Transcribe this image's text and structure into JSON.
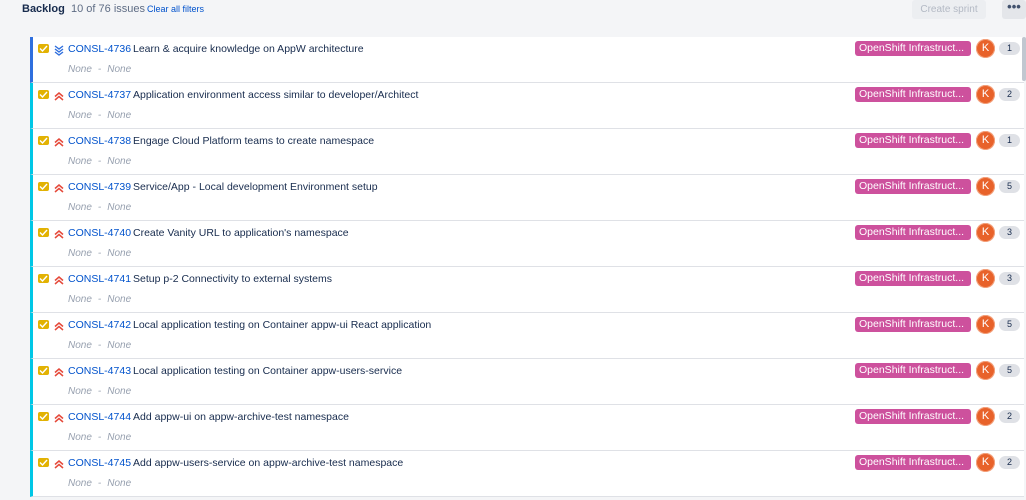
{
  "header": {
    "title": "Backlog",
    "issue_count": "10 of 76 issues",
    "clear_filters": "Clear all filters",
    "create_sprint": "Create sprint",
    "more_icon": "more-horizontal-icon",
    "more_label": "•••"
  },
  "colors": {
    "epic": "#cd519d",
    "avatar": "#e8622a",
    "story_icon": "#e2b203",
    "priority_high": "#e5493a",
    "priority_lowest": "#2f6fde"
  },
  "issues": [
    {
      "key": "CONSL-4736",
      "summary": "Learn & acquire knowledge on AppW architecture",
      "type_icon": "story-icon",
      "priority": "lowest",
      "priority_icon": "priority-lowest-icon",
      "meta1": "None",
      "meta2": "None",
      "epic": "OpenShift Infrastruct...",
      "avatar": "K",
      "points": "1"
    },
    {
      "key": "CONSL-4737",
      "summary": "Application environment access similar to developer/Architect",
      "type_icon": "story-icon",
      "priority": "high",
      "priority_icon": "priority-high-icon",
      "meta1": "None",
      "meta2": "None",
      "epic": "OpenShift Infrastruct...",
      "avatar": "K",
      "points": "2"
    },
    {
      "key": "CONSL-4738",
      "summary": "Engage Cloud Platform teams to create namespace",
      "type_icon": "story-icon",
      "priority": "high",
      "priority_icon": "priority-high-icon",
      "meta1": "None",
      "meta2": "None",
      "epic": "OpenShift Infrastruct...",
      "avatar": "K",
      "points": "1"
    },
    {
      "key": "CONSL-4739",
      "summary": "Service/App - Local development Environment setup",
      "type_icon": "story-icon",
      "priority": "high",
      "priority_icon": "priority-high-icon",
      "meta1": "None",
      "meta2": "None",
      "epic": "OpenShift Infrastruct...",
      "avatar": "K",
      "points": "5"
    },
    {
      "key": "CONSL-4740",
      "summary": "Create Vanity URL to application's namespace",
      "type_icon": "story-icon",
      "priority": "high",
      "priority_icon": "priority-high-icon",
      "meta1": "None",
      "meta2": "None",
      "epic": "OpenShift Infrastruct...",
      "avatar": "K",
      "points": "3"
    },
    {
      "key": "CONSL-4741",
      "summary": "Setup p-2 Connectivity to external systems",
      "type_icon": "story-icon",
      "priority": "high",
      "priority_icon": "priority-high-icon",
      "meta1": "None",
      "meta2": "None",
      "epic": "OpenShift Infrastruct...",
      "avatar": "K",
      "points": "3"
    },
    {
      "key": "CONSL-4742",
      "summary": "Local application testing on Container appw-ui React application",
      "type_icon": "story-icon",
      "priority": "high",
      "priority_icon": "priority-high-icon",
      "meta1": "None",
      "meta2": "None",
      "epic": "OpenShift Infrastruct...",
      "avatar": "K",
      "points": "5"
    },
    {
      "key": "CONSL-4743",
      "summary": "Local application testing on Container appw-users-service",
      "type_icon": "story-icon",
      "priority": "high",
      "priority_icon": "priority-high-icon",
      "meta1": "None",
      "meta2": "None",
      "epic": "OpenShift Infrastruct...",
      "avatar": "K",
      "points": "5"
    },
    {
      "key": "CONSL-4744",
      "summary": "Add appw-ui on appw-archive-test namespace",
      "type_icon": "story-icon",
      "priority": "high",
      "priority_icon": "priority-high-icon",
      "meta1": "None",
      "meta2": "None",
      "epic": "OpenShift Infrastruct...",
      "avatar": "K",
      "points": "2"
    },
    {
      "key": "CONSL-4745",
      "summary": "Add appw-users-service on appw-archive-test namespace",
      "type_icon": "story-icon",
      "priority": "high",
      "priority_icon": "priority-high-icon",
      "meta1": "None",
      "meta2": "None",
      "epic": "OpenShift Infrastruct...",
      "avatar": "K",
      "points": "2"
    }
  ]
}
